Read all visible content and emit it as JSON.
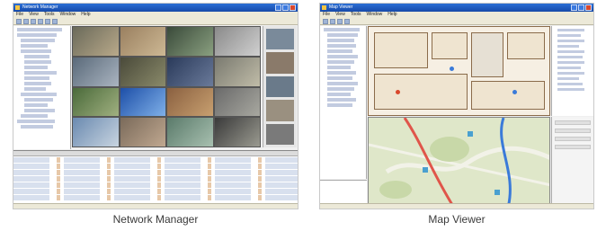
{
  "panels": [
    {
      "caption": "Network Manager",
      "window_title": "Network Manager",
      "menu": [
        "File",
        "View",
        "Tools",
        "Window",
        "Help"
      ]
    },
    {
      "caption": "Map Viewer",
      "window_title": "Map Viewer",
      "menu": [
        "File",
        "View",
        "Tools",
        "Window",
        "Help"
      ]
    }
  ],
  "colors": {
    "titlebar": "#2b6fd6",
    "window_bg": "#ece9d8",
    "route_red": "#e0554a",
    "route_blue": "#3a7ad9"
  }
}
